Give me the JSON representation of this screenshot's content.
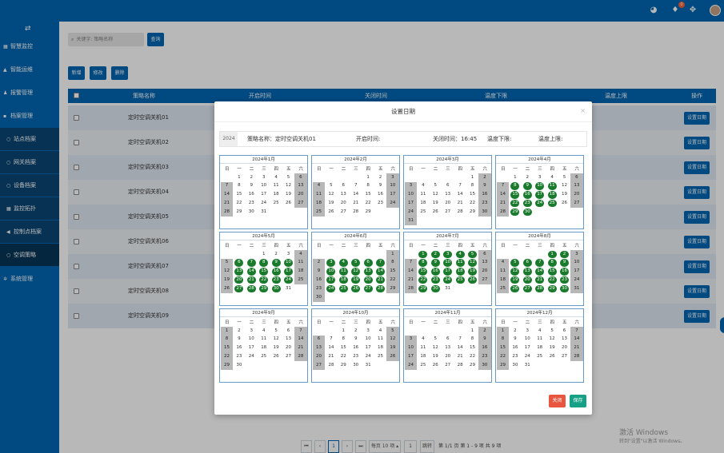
{
  "topbar": {
    "icons": [
      {
        "name": "dashboard-icon",
        "glyph": "◕"
      },
      {
        "name": "notification-icon",
        "glyph": "♦",
        "badge": "0"
      },
      {
        "name": "bell-icon",
        "glyph": "▲",
        "badge": "0"
      },
      {
        "name": "fullscreen-icon",
        "glyph": "✥"
      }
    ],
    "colors": {
      "brand": "#0066b3",
      "badge": "#f0623b"
    }
  },
  "sidebar": {
    "toggle_glyph": "⇄",
    "items": [
      {
        "label": "智慧监控",
        "icon": "grid-icon",
        "glyph": "▦",
        "type": "top"
      },
      {
        "label": "智能运维",
        "icon": "user-icon",
        "glyph": "▲",
        "type": "top"
      },
      {
        "label": "报警管理",
        "icon": "bell-icon",
        "glyph": "♟",
        "type": "top"
      },
      {
        "label": "档案管理",
        "icon": "doc-icon",
        "glyph": "▪",
        "type": "top"
      },
      {
        "label": "站点档案",
        "icon": "circle-icon",
        "glyph": "○",
        "type": "sub"
      },
      {
        "label": "网关档案",
        "icon": "circle-icon",
        "glyph": "○",
        "type": "sub"
      },
      {
        "label": "设备档案",
        "icon": "circle-icon",
        "glyph": "○",
        "type": "sub"
      },
      {
        "label": "监控拓扑",
        "icon": "topology-icon",
        "glyph": "▦",
        "type": "sub"
      },
      {
        "label": "控制点档案",
        "icon": "broadcast-icon",
        "glyph": "◀",
        "type": "sub"
      },
      {
        "label": "空调策略",
        "icon": "circle-icon",
        "glyph": "○",
        "type": "active"
      },
      {
        "label": "系统管理",
        "icon": "gear-icon",
        "glyph": "✲",
        "type": "top"
      }
    ]
  },
  "search": {
    "placeholder": "关键字: 策略名称",
    "query_label": "查询"
  },
  "toolbar": {
    "add_label": "新增",
    "edit_label": "修改",
    "delete_label": "删除"
  },
  "table": {
    "headers": [
      "策略名称",
      "开启时间",
      "关闭时间",
      "温度下限",
      "温度上限",
      "操作"
    ],
    "rows": [
      "定时空调关机01",
      "定时空调关机02",
      "定时空调关机03",
      "定时空调关机04",
      "定时空调关机05",
      "定时空调关机06",
      "定时空调关机07",
      "定时空调关机08",
      "定时空调关机09"
    ],
    "action_label": "设置日期"
  },
  "pagination": {
    "first": "⏮",
    "prev": "‹",
    "current": "1",
    "next": "›",
    "last": "⏭",
    "page_size": "每页 10 项 ▴",
    "goto_value": "1",
    "goto_label": "跳转",
    "summary": "第 1/1 页 第 1 - 9 项 共 9 项"
  },
  "watermark": {
    "title": "激活 Windows",
    "subtitle": "转到\"设置\"以激活 Windows。"
  },
  "modal": {
    "title": "设置日期",
    "close_glyph": "×",
    "year": "2024",
    "name_text": "策略名称：定时空调关机01",
    "open_time_text": "开启时间:",
    "close_time_text": "关闭时间：16:45",
    "temp_low_text": "温度下限:",
    "temp_high_text": "温度上限:",
    "close_button": "关闭",
    "save_button": "保存",
    "weekday_labels": [
      "日",
      "一",
      "二",
      "三",
      "四",
      "五",
      "六"
    ],
    "months": [
      {
        "title": "2024年1月",
        "start": 1,
        "days": 31,
        "selected": []
      },
      {
        "title": "2024年2月",
        "start": 4,
        "days": 29,
        "selected": []
      },
      {
        "title": "2024年3月",
        "start": 5,
        "days": 31,
        "selected": []
      },
      {
        "title": "2024年4月",
        "start": 1,
        "days": 30,
        "selected": [
          8,
          9,
          10,
          11,
          15,
          16,
          17,
          18,
          22,
          23,
          24,
          25,
          29,
          30
        ]
      },
      {
        "title": "2024年5月",
        "start": 3,
        "days": 31,
        "selected": [
          6,
          7,
          8,
          9,
          10,
          13,
          14,
          15,
          16,
          17,
          20,
          21,
          22,
          23,
          24,
          27,
          28,
          29,
          30
        ]
      },
      {
        "title": "2024年6月",
        "start": 6,
        "days": 30,
        "selected": [
          3,
          4,
          5,
          6,
          7,
          10,
          11,
          12,
          13,
          14,
          17,
          18,
          19,
          20,
          21,
          24,
          25,
          26,
          27,
          28
        ]
      },
      {
        "title": "2024年7月",
        "start": 1,
        "days": 31,
        "selected": [
          1,
          2,
          3,
          4,
          5,
          8,
          9,
          10,
          11,
          12,
          15,
          16,
          17,
          18,
          19,
          22,
          23,
          24,
          25,
          26,
          29,
          30
        ]
      },
      {
        "title": "2024年8月",
        "start": 4,
        "days": 31,
        "selected": [
          1,
          2,
          5,
          6,
          7,
          8,
          9,
          12,
          13,
          14,
          15,
          16,
          19,
          20,
          21,
          22,
          23,
          26,
          27,
          28,
          29,
          30
        ]
      },
      {
        "title": "2024年9月",
        "start": 0,
        "days": 30,
        "selected": []
      },
      {
        "title": "2024年10月",
        "start": 2,
        "days": 31,
        "selected": []
      },
      {
        "title": "2024年11月",
        "start": 5,
        "days": 30,
        "selected": []
      },
      {
        "title": "2024年12月",
        "start": 0,
        "days": 31,
        "selected": []
      }
    ],
    "colors": {
      "selected": "#1a7a2c",
      "weekend": "#b7b7b7",
      "close": "#e8563f",
      "save": "#16a085"
    }
  }
}
